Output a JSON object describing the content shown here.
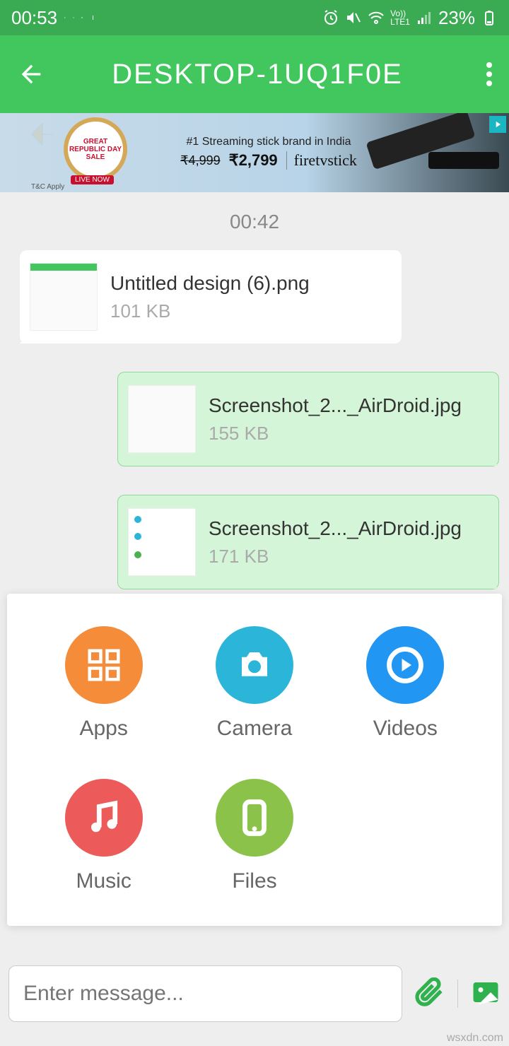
{
  "status": {
    "time": "00:53",
    "battery": "23%"
  },
  "header": {
    "title": "DESKTOP-1UQ1F0E"
  },
  "ad": {
    "badge_text": "GREAT REPUBLIC DAY SALE",
    "live_label": "LIVE NOW",
    "tc_label": "T&C Apply",
    "tagline": "#1 Streaming stick brand in India",
    "old_price": "₹4,999",
    "new_price": "₹2,799",
    "brand": "firetvstick"
  },
  "chat": {
    "timestamp": "00:42",
    "messages": [
      {
        "direction": "received",
        "filename": "Untitled design (6).png",
        "size": "101 KB"
      },
      {
        "direction": "sent",
        "filename": "Screenshot_2..._AirDroid.jpg",
        "size": "155 KB"
      },
      {
        "direction": "sent",
        "filename": "Screenshot_2..._AirDroid.jpg",
        "size": "171 KB"
      }
    ]
  },
  "attach": {
    "items": [
      {
        "label": "Apps",
        "color": "c-orange",
        "icon": "grid"
      },
      {
        "label": "Camera",
        "color": "c-cyan",
        "icon": "camera"
      },
      {
        "label": "Videos",
        "color": "c-blue",
        "icon": "play"
      },
      {
        "label": "Music",
        "color": "c-red",
        "icon": "music"
      },
      {
        "label": "Files",
        "color": "c-green",
        "icon": "phone"
      }
    ]
  },
  "input": {
    "placeholder": "Enter message..."
  },
  "watermark": "wsxdn.com"
}
